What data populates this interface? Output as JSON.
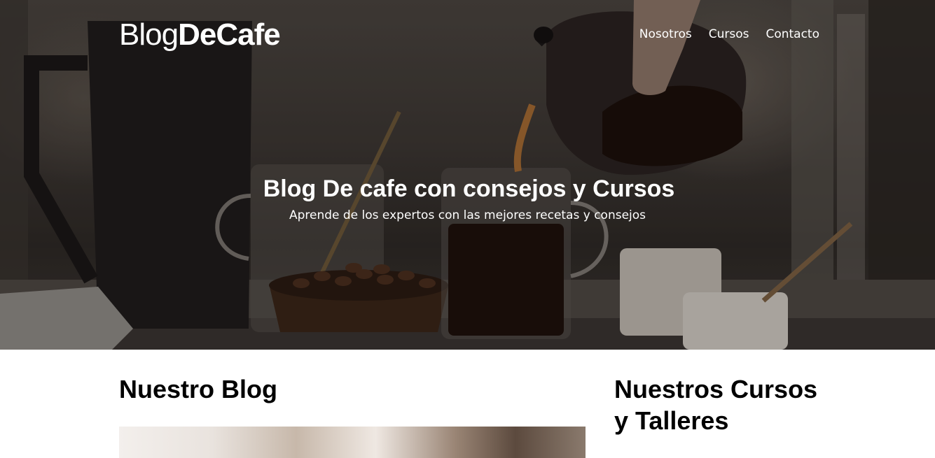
{
  "header": {
    "logo_light": "Blog",
    "logo_bold": "DeCafe",
    "nav": [
      {
        "label": "Nosotros"
      },
      {
        "label": "Cursos"
      },
      {
        "label": "Contacto"
      }
    ]
  },
  "hero": {
    "title": "Blog De cafe con consejos y Cursos",
    "subtitle": "Aprende de los expertos con las mejores recetas y consejos"
  },
  "blog": {
    "heading": "Nuestro Blog"
  },
  "courses": {
    "heading": "Nuestros Cursos y Talleres"
  }
}
